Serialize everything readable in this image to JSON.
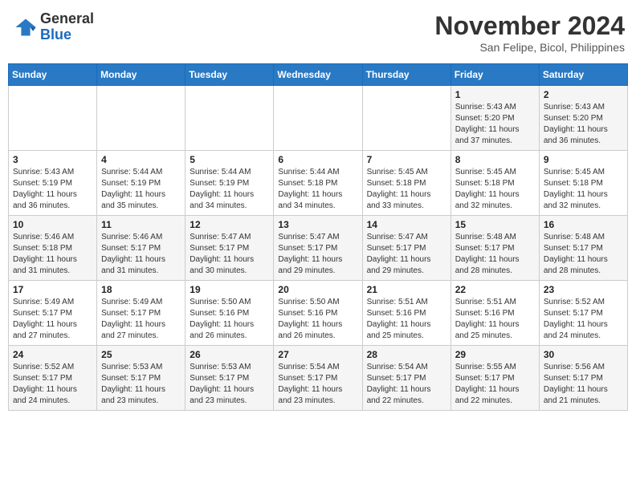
{
  "header": {
    "logo_general": "General",
    "logo_blue": "Blue",
    "month_year": "November 2024",
    "location": "San Felipe, Bicol, Philippines"
  },
  "calendar": {
    "days_of_week": [
      "Sunday",
      "Monday",
      "Tuesday",
      "Wednesday",
      "Thursday",
      "Friday",
      "Saturday"
    ],
    "weeks": [
      [
        {
          "day": "",
          "info": ""
        },
        {
          "day": "",
          "info": ""
        },
        {
          "day": "",
          "info": ""
        },
        {
          "day": "",
          "info": ""
        },
        {
          "day": "",
          "info": ""
        },
        {
          "day": "1",
          "info": "Sunrise: 5:43 AM\nSunset: 5:20 PM\nDaylight: 11 hours\nand 37 minutes."
        },
        {
          "day": "2",
          "info": "Sunrise: 5:43 AM\nSunset: 5:20 PM\nDaylight: 11 hours\nand 36 minutes."
        }
      ],
      [
        {
          "day": "3",
          "info": "Sunrise: 5:43 AM\nSunset: 5:19 PM\nDaylight: 11 hours\nand 36 minutes."
        },
        {
          "day": "4",
          "info": "Sunrise: 5:44 AM\nSunset: 5:19 PM\nDaylight: 11 hours\nand 35 minutes."
        },
        {
          "day": "5",
          "info": "Sunrise: 5:44 AM\nSunset: 5:19 PM\nDaylight: 11 hours\nand 34 minutes."
        },
        {
          "day": "6",
          "info": "Sunrise: 5:44 AM\nSunset: 5:18 PM\nDaylight: 11 hours\nand 34 minutes."
        },
        {
          "day": "7",
          "info": "Sunrise: 5:45 AM\nSunset: 5:18 PM\nDaylight: 11 hours\nand 33 minutes."
        },
        {
          "day": "8",
          "info": "Sunrise: 5:45 AM\nSunset: 5:18 PM\nDaylight: 11 hours\nand 32 minutes."
        },
        {
          "day": "9",
          "info": "Sunrise: 5:45 AM\nSunset: 5:18 PM\nDaylight: 11 hours\nand 32 minutes."
        }
      ],
      [
        {
          "day": "10",
          "info": "Sunrise: 5:46 AM\nSunset: 5:18 PM\nDaylight: 11 hours\nand 31 minutes."
        },
        {
          "day": "11",
          "info": "Sunrise: 5:46 AM\nSunset: 5:17 PM\nDaylight: 11 hours\nand 31 minutes."
        },
        {
          "day": "12",
          "info": "Sunrise: 5:47 AM\nSunset: 5:17 PM\nDaylight: 11 hours\nand 30 minutes."
        },
        {
          "day": "13",
          "info": "Sunrise: 5:47 AM\nSunset: 5:17 PM\nDaylight: 11 hours\nand 29 minutes."
        },
        {
          "day": "14",
          "info": "Sunrise: 5:47 AM\nSunset: 5:17 PM\nDaylight: 11 hours\nand 29 minutes."
        },
        {
          "day": "15",
          "info": "Sunrise: 5:48 AM\nSunset: 5:17 PM\nDaylight: 11 hours\nand 28 minutes."
        },
        {
          "day": "16",
          "info": "Sunrise: 5:48 AM\nSunset: 5:17 PM\nDaylight: 11 hours\nand 28 minutes."
        }
      ],
      [
        {
          "day": "17",
          "info": "Sunrise: 5:49 AM\nSunset: 5:17 PM\nDaylight: 11 hours\nand 27 minutes."
        },
        {
          "day": "18",
          "info": "Sunrise: 5:49 AM\nSunset: 5:17 PM\nDaylight: 11 hours\nand 27 minutes."
        },
        {
          "day": "19",
          "info": "Sunrise: 5:50 AM\nSunset: 5:16 PM\nDaylight: 11 hours\nand 26 minutes."
        },
        {
          "day": "20",
          "info": "Sunrise: 5:50 AM\nSunset: 5:16 PM\nDaylight: 11 hours\nand 26 minutes."
        },
        {
          "day": "21",
          "info": "Sunrise: 5:51 AM\nSunset: 5:16 PM\nDaylight: 11 hours\nand 25 minutes."
        },
        {
          "day": "22",
          "info": "Sunrise: 5:51 AM\nSunset: 5:16 PM\nDaylight: 11 hours\nand 25 minutes."
        },
        {
          "day": "23",
          "info": "Sunrise: 5:52 AM\nSunset: 5:17 PM\nDaylight: 11 hours\nand 24 minutes."
        }
      ],
      [
        {
          "day": "24",
          "info": "Sunrise: 5:52 AM\nSunset: 5:17 PM\nDaylight: 11 hours\nand 24 minutes."
        },
        {
          "day": "25",
          "info": "Sunrise: 5:53 AM\nSunset: 5:17 PM\nDaylight: 11 hours\nand 23 minutes."
        },
        {
          "day": "26",
          "info": "Sunrise: 5:53 AM\nSunset: 5:17 PM\nDaylight: 11 hours\nand 23 minutes."
        },
        {
          "day": "27",
          "info": "Sunrise: 5:54 AM\nSunset: 5:17 PM\nDaylight: 11 hours\nand 23 minutes."
        },
        {
          "day": "28",
          "info": "Sunrise: 5:54 AM\nSunset: 5:17 PM\nDaylight: 11 hours\nand 22 minutes."
        },
        {
          "day": "29",
          "info": "Sunrise: 5:55 AM\nSunset: 5:17 PM\nDaylight: 11 hours\nand 22 minutes."
        },
        {
          "day": "30",
          "info": "Sunrise: 5:56 AM\nSunset: 5:17 PM\nDaylight: 11 hours\nand 21 minutes."
        }
      ]
    ]
  }
}
